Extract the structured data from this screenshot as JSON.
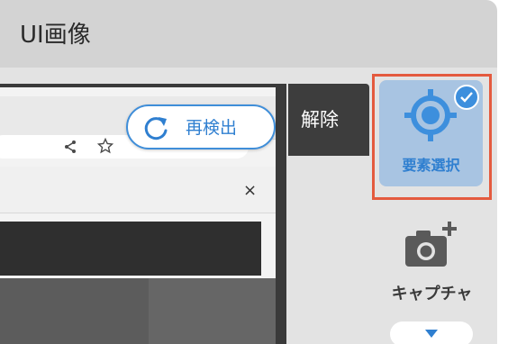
{
  "window": {
    "title": "UI画像"
  },
  "screenshot": {
    "rescan_label": "再検出",
    "icons": [
      "share-icon",
      "star-icon",
      "close-icon"
    ],
    "close_glyph": "×"
  },
  "toolbar": {
    "release_label": "解除",
    "element_select": {
      "label": "要素選択",
      "selected": true,
      "icon": "target-icon"
    },
    "capture": {
      "label": "キャプチャ",
      "icon": "camera-plus-icon"
    },
    "dropdown": {
      "icon": "chevron-down-icon"
    }
  },
  "colors": {
    "accent": "#2f7fd0",
    "highlight_border": "#e45a3e",
    "selected_tile": "#a8c4e2",
    "title_bar": "#d3d3d3"
  }
}
